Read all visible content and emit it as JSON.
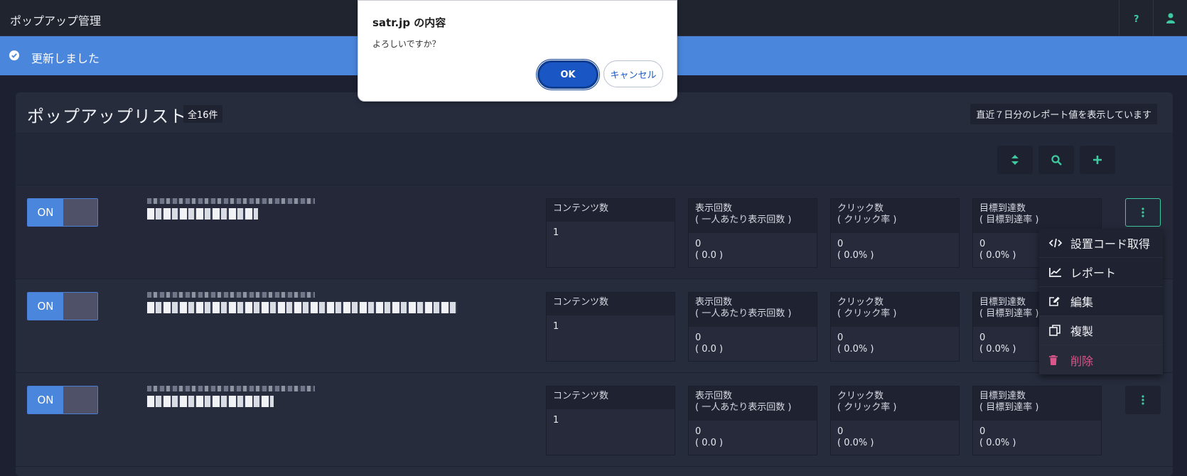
{
  "header": {
    "title": "ポップアップ管理",
    "help_icon": "question-icon",
    "user_icon": "user-icon"
  },
  "alert": {
    "message": "更新しました",
    "icon": "check-circle-icon"
  },
  "panel": {
    "title": "ポップアップリスト",
    "count": "全16件",
    "period_note": "直近７日分のレポート値を表示しています"
  },
  "toolbar": {
    "sort_icon": "sort-icon",
    "search_icon": "search-icon",
    "add_icon": "plus-icon"
  },
  "stat_labels": {
    "contents": "コンテンツ数",
    "views": "表示回数",
    "views_sub": "( 一人あたり表示回数 )",
    "clicks": "クリック数",
    "clicks_sub": "( クリック率 )",
    "goals": "目標到達数",
    "goals_sub": "( 目標到達率 )"
  },
  "rows": [
    {
      "toggle": "ON",
      "contents": "1",
      "views": "0",
      "views_rate": "( 0.0 )",
      "clicks": "0",
      "clicks_rate": "( 0.0% )",
      "goals": "0",
      "goals_rate": "( 0.0% )"
    },
    {
      "toggle": "ON",
      "contents": "1",
      "views": "0",
      "views_rate": "( 0.0 )",
      "clicks": "0",
      "clicks_rate": "( 0.0% )",
      "goals": "0",
      "goals_rate": "( 0.0% )"
    },
    {
      "toggle": "ON",
      "contents": "1",
      "views": "0",
      "views_rate": "( 0.0 )",
      "clicks": "0",
      "clicks_rate": "( 0.0% )",
      "goals": "0",
      "goals_rate": "( 0.0% )"
    }
  ],
  "dropdown": {
    "items": [
      {
        "label": "設置コード取得",
        "icon": "code-icon"
      },
      {
        "label": "レポート",
        "icon": "chart-line-icon"
      },
      {
        "label": "編集",
        "icon": "edit-icon"
      },
      {
        "label": "複製",
        "icon": "copy-icon"
      },
      {
        "label": "削除",
        "icon": "trash-icon"
      }
    ]
  },
  "dialog": {
    "title": "satr.jp の内容",
    "message": "よろしいですか？",
    "ok_label": "OK",
    "cancel_label": "キャンセル"
  },
  "colors": {
    "accent_blue": "#4a86dc",
    "accent_green": "#3ec9a0",
    "danger": "#d9568a",
    "background": "#1c2030"
  }
}
